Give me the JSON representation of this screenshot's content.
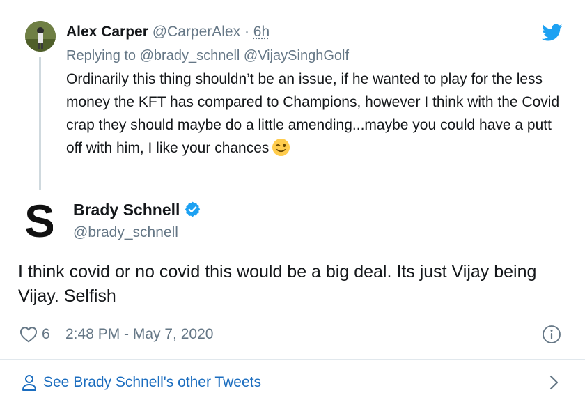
{
  "parent_tweet": {
    "name": "Alex Carper",
    "handle": "@CarperAlex",
    "separator": "·",
    "time": "6h",
    "replying_prefix": "Replying to",
    "replying_to": "@brady_schnell @VijaySinghGolf",
    "text": "Ordinarily this thing shouldn’t be an issue, if he wanted to play for the less money the KFT has compared to Champions, however I think with the Covid crap they should maybe do a little amending...maybe you could have a putt off with him, I like your chances",
    "emoji": "winking-face"
  },
  "main_tweet": {
    "name": "Brady Schnell",
    "handle": "@brady_schnell",
    "verified": true,
    "text": "I think covid or no covid this would be a big deal. Its just Vijay being Vijay. Selfish",
    "likes": "6",
    "timestamp": "2:48 PM - May 7, 2020"
  },
  "footer": {
    "see_more_label": "See Brady Schnell's other Tweets"
  },
  "icons": {
    "brand": "twitter-bird-icon",
    "like": "heart-icon",
    "info": "info-icon",
    "profile": "person-icon",
    "chevron": "chevron-right-icon"
  },
  "colors": {
    "twitter_blue": "#1da1f2",
    "link_blue": "#1b6dbf",
    "secondary_text": "#657786",
    "primary_text": "#14171a"
  }
}
